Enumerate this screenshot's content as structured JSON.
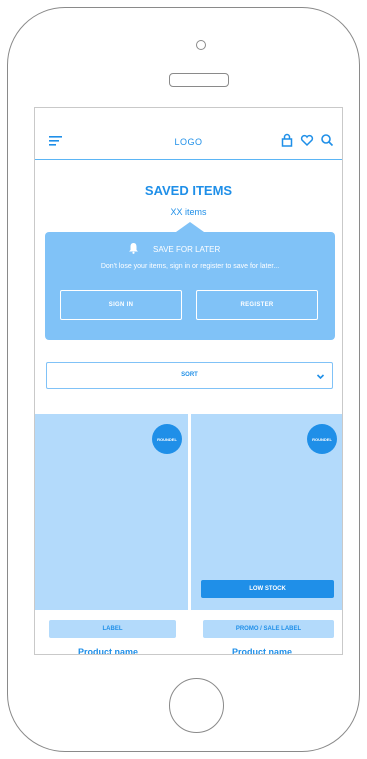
{
  "header": {
    "logo": "LOGO",
    "icons": [
      "menu-icon",
      "bag-icon",
      "heart-icon",
      "search-icon"
    ]
  },
  "page": {
    "title": "SAVED ITEMS",
    "count": "XX items"
  },
  "save_panel": {
    "icon": "bell-icon",
    "title": "SAVE FOR LATER",
    "text": "Don't lose your items, sign in or register to save for later...",
    "sign_in": "SIGN IN",
    "register": "REGISTER"
  },
  "sort": {
    "label": "SORT",
    "icon": "chevron-down-icon"
  },
  "products": [
    {
      "roundel": "ROUNDEL",
      "label": "LABEL",
      "name": "Product name"
    },
    {
      "roundel": "ROUNDEL",
      "badge": "LOW STOCK",
      "label": "PROMO / SALE LABEL",
      "name": "Product name"
    }
  ],
  "colors": {
    "accent": "#1f8fe8",
    "panel": "#80c2f7",
    "image_placeholder": "#b3dafb"
  }
}
